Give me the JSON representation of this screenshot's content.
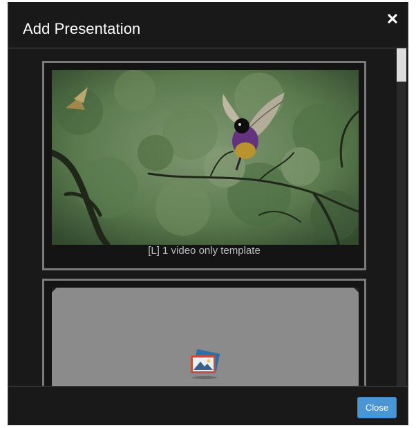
{
  "modal": {
    "title": "Add Presentation",
    "close_icon": "close-icon"
  },
  "templates": [
    {
      "label": "[L] 1 video only template",
      "thumbnail": "bird-video-thumbnail"
    },
    {
      "label": "",
      "thumbnail": "image-placeholder-icon"
    }
  ],
  "footer": {
    "close_label": "Close"
  },
  "colors": {
    "modal_bg": "#191919",
    "accent": "#4a95d4",
    "card_border": "#7a7a7a"
  }
}
